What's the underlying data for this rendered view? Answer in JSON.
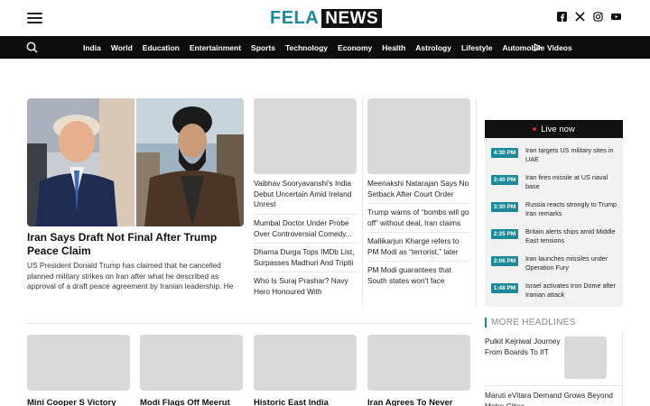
{
  "header": {
    "logo_part1": "FELA",
    "logo_part2": "NEWS",
    "menu_icon": "hamburger-icon",
    "social_icons": [
      "facebook-icon",
      "x-icon",
      "instagram-icon",
      "youtube-icon"
    ]
  },
  "nav": {
    "items": [
      "India",
      "World",
      "Education",
      "Entertainment",
      "Sports",
      "Technology",
      "Economy",
      "Health",
      "Astrology",
      "Lifestyle",
      "Automobile"
    ],
    "videos_label": "Videos"
  },
  "lead": {
    "title": "Iran Says Draft Not Final After Trump Peace Claim",
    "summary": "US President Donald Trump has claimed that he cancelled planned military strikes on Iran after what he described as approval of a draft peace agreement by Iranian leadership. He said the propose..."
  },
  "col1": {
    "stories": [
      "Vaibhav Sooryavanshi's India Debut Uncertain Amid Ireland Unrest",
      "Mumbai Doctor Under Probe Over Controversial Comedy...",
      "Dharna Durga Tops IMDb List, Surpasses Madhuri And Triptii",
      "Who Is Suraj Prashar? Navy Hero Honoured With Shaurya..."
    ]
  },
  "col2": {
    "stories": [
      "Meenakshi Natarajan Says No Setback After Court Order",
      "Trump warns of “bombs will go off” without deal, Iran claims it...",
      "Mallikarjun Kharge refers to PM Modi as “terrorist,” later clarifi...",
      "PM Modi guarantees that South states won't face discriminati..."
    ]
  },
  "live": {
    "title": "Live now",
    "items": [
      {
        "time": "4:30 PM",
        "text": "Iran targets US military sites in UAE"
      },
      {
        "time": "3:40 PM",
        "text": "Iran fires missile at US naval base"
      },
      {
        "time": "3:30 PM",
        "text": "Russia reacts strongly to Trump Iran remarks"
      },
      {
        "time": "2:25 PM",
        "text": "Britain alerts ships amid Middle East tensions"
      },
      {
        "time": "2:06 PM",
        "text": "Iran launches missiles under Operation Fury"
      },
      {
        "time": "1:48 PM",
        "text": "Israel activates Iron Dome after Iranian attack"
      }
    ]
  },
  "more": {
    "title": "MORE HEADLINES",
    "items": [
      "Pulkit Kejriwal Journey From Boards To IIT",
      "Maruti eVitara Demand Grows Beyond Metro Cities"
    ]
  },
  "bottom": {
    "cards": [
      "Mini Cooper S Victory",
      "Modi Flags Off Meerut",
      "Historic East India",
      "Iran Agrees To Never"
    ]
  },
  "colors": {
    "accent": "#1a8a9a",
    "nav_bg": "#0d0d0d",
    "live_dot": "#d72525"
  }
}
